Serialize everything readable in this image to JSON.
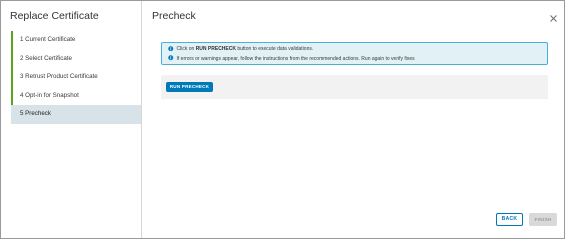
{
  "wizard": {
    "title": "Replace Certificate",
    "steps": [
      {
        "label": "1 Current Certificate"
      },
      {
        "label": "2 Select Certificate"
      },
      {
        "label": "3 Retrust Product Certificate"
      },
      {
        "label": "4 Opt-in for Snapshot"
      },
      {
        "label": "5 Precheck"
      }
    ],
    "active_step": 5
  },
  "page": {
    "title": "Precheck",
    "close_icon": "close-icon"
  },
  "alert": {
    "icon": "info-icon",
    "line1_prefix": "Click on",
    "line1_bold": "RUN PRECHECK",
    "line1_suffix": "button to execute data validations.",
    "line2": "If errors or warnings appear, follow the instructions from the recommended actions. Run again to verify fixes"
  },
  "actions": {
    "run_precheck_label": "RUN PRECHECK"
  },
  "footer": {
    "back_label": "BACK",
    "finish_label": "FINISH"
  },
  "colors": {
    "accent": "#0079b8",
    "step_indicator": "#5aa220",
    "active_step_bg": "#d8e3e9",
    "alert_bg": "#e1f1f6",
    "alert_border": "#49afd9"
  }
}
